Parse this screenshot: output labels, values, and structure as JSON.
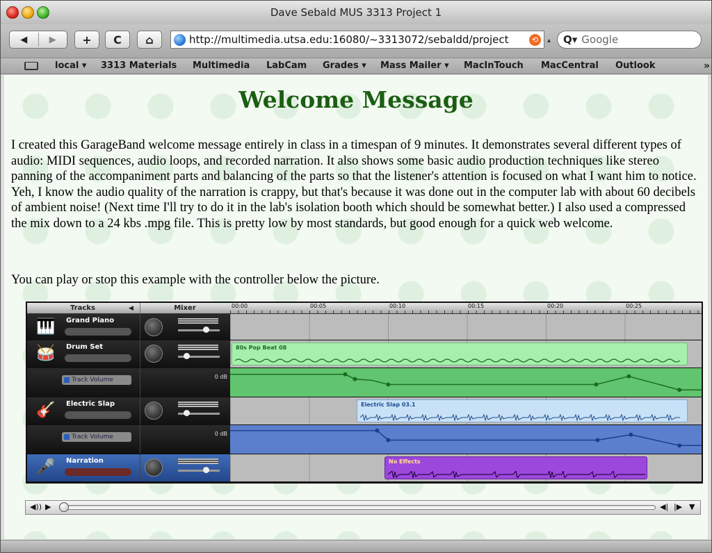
{
  "window": {
    "title": "Dave Sebald MUS 3313 Project 1"
  },
  "toolbar": {
    "back_icon": "back-arrow-icon",
    "forward_icon": "forward-arrow-icon",
    "add_label": "+",
    "reload_label": "C",
    "home_label": "⌂",
    "url": "http://multimedia.utsa.edu:16080/~3313072/sebaldd/project",
    "search_placeholder": "Google"
  },
  "bookmarks": {
    "items": [
      {
        "label": "local ▾"
      },
      {
        "label": "3313 Materials"
      },
      {
        "label": "Multimedia"
      },
      {
        "label": "LabCam"
      },
      {
        "label": "Grades ▾"
      },
      {
        "label": "Mass Mailer ▾"
      },
      {
        "label": "MacInTouch"
      },
      {
        "label": "MacCentral"
      },
      {
        "label": "Outlook"
      }
    ],
    "more": "»"
  },
  "page": {
    "title": "Welcome Message",
    "paragraph1": "I created this GarageBand welcome message entirely in class in a timespan of 9 minutes. It demonstrates several different types of audio: MIDI sequences, audio loops, and recorded narration. It also shows some basic audio production techniques like stereo panning of the accompaniment parts and balancing of the parts so that the listener's attention is focused on what I want him to notice. Yeh, I know the audio quality of the narration is crappy, but that's because it was done out in the computer lab with about 60 decibels of ambient noise! (Next time I'll try to do it in the lab's isolation booth which should be somewhat better.) I also used a compressed the mix down to a 24 kbs .mpg file. This is pretty low by most standards, but good enough for a quick web welcome.",
    "paragraph2": "You can play or stop this example with the controller below the picture."
  },
  "garageband": {
    "header_tracks": "Tracks",
    "header_mixer": "Mixer",
    "ruler_ticks": [
      "00:00",
      "00:05",
      "00:10",
      "00:15",
      "00:20",
      "00:25"
    ],
    "track_volume_label": "Track Volume",
    "zero_db_label": "0 dB",
    "tracks": [
      {
        "name": "Grand Piano",
        "icon": "piano-icon"
      },
      {
        "name": "Drum Set",
        "icon": "drum-icon",
        "region": "80s Pop Beat 08"
      },
      {
        "name": "Electric Slap",
        "icon": "bass-guitar-icon",
        "region": "Electric Slap 03.1"
      },
      {
        "name": "Narration",
        "icon": "microphone-icon",
        "region": "No Effects"
      }
    ]
  },
  "controller": {
    "volume_icon": "speaker-icon",
    "play_icon": "play-icon",
    "step_back_icon": "step-back-icon",
    "step_forward_icon": "step-forward-icon",
    "menu_icon": "dropdown-menu-icon",
    "progress": 0
  },
  "colors": {
    "title_green": "#1b5e12",
    "drum_region": "#9be8a0",
    "slap_region": "#c5def6",
    "narration_region": "#9a44d8"
  }
}
